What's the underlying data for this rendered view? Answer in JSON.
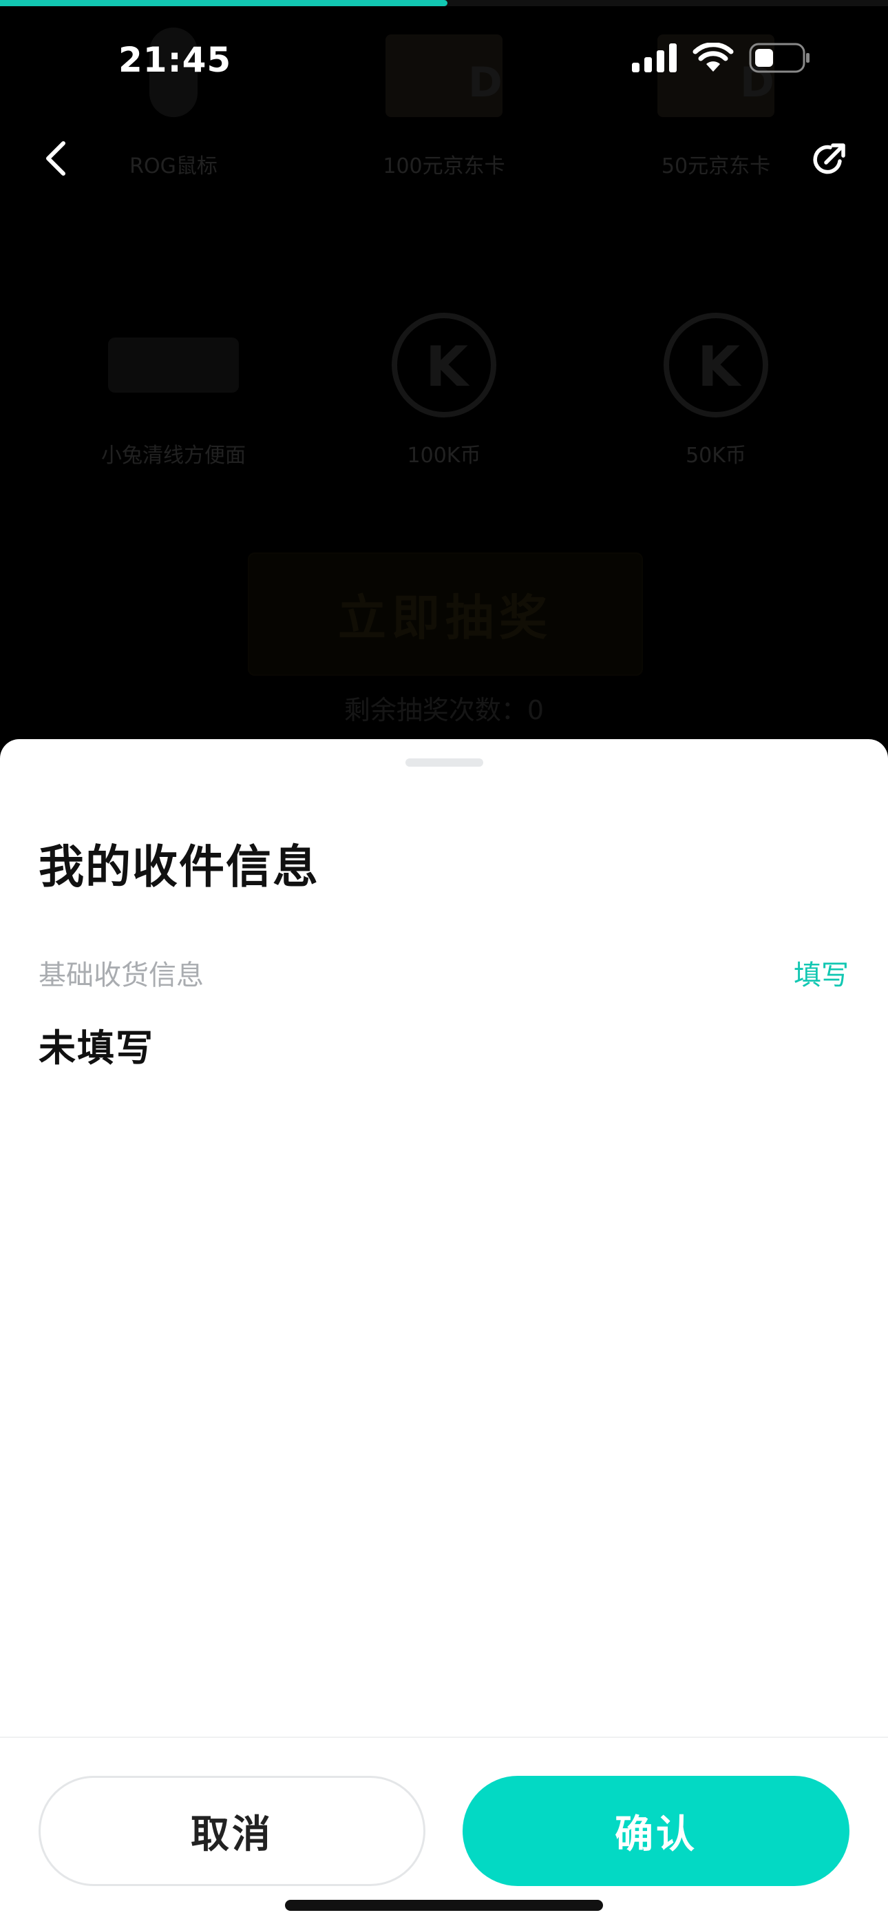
{
  "status_bar": {
    "time": "21:45"
  },
  "progress": {
    "fraction": 0.504,
    "color": "#12c7b2"
  },
  "background": {
    "prizes": [
      {
        "label": "ROG鼠标"
      },
      {
        "label": "100元京东卡"
      },
      {
        "label": "50元京东卡"
      },
      {
        "label": "小兔清线方便面"
      },
      {
        "label": "100K币"
      },
      {
        "label": "50K币"
      }
    ],
    "draw_button_label": "立即抽奖",
    "remaining_draws": "剩余抽奖次数：0"
  },
  "sheet": {
    "title": "我的收件信息",
    "section_label": "基础收货信息",
    "fill_link": "填写",
    "address_value": "未填写",
    "cancel_label": "取消",
    "confirm_label": "确认"
  },
  "colors": {
    "accent": "#03d9c4",
    "accent_text": "#12c7b2",
    "muted_text": "#a9acb0"
  },
  "icons": {
    "back": "chevron-left-icon",
    "share": "share-icon",
    "signal": "cellular-signal-icon",
    "wifi": "wifi-icon",
    "battery": "battery-icon"
  }
}
